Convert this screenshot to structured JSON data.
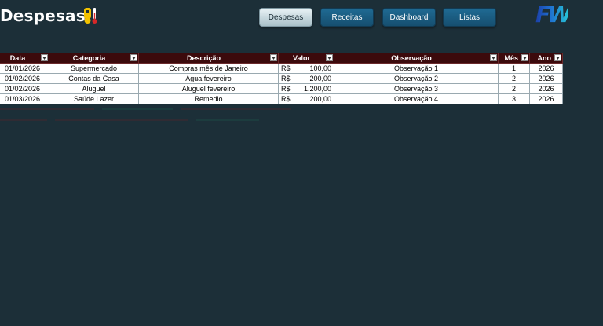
{
  "header": {
    "title": "Despesas",
    "icon": "thermometer-money-icon",
    "logo": "FW"
  },
  "nav": {
    "buttons": [
      {
        "label": "Despesas",
        "active": true
      },
      {
        "label": "Receitas",
        "active": false
      },
      {
        "label": "Dashboard",
        "active": false
      },
      {
        "label": "Listas",
        "active": false
      }
    ]
  },
  "table": {
    "headers": [
      "Data",
      "Categoria",
      "Descrição",
      "Valor",
      "Observação",
      "Mês",
      "Ano"
    ],
    "rows": [
      {
        "data": "01/01/2026",
        "categoria": "Supermercado",
        "descricao": "Compras mês de Janeiro",
        "moeda": "R$",
        "valor": "100,00",
        "observacao": "Observação 1",
        "mes": "1",
        "ano": "2026"
      },
      {
        "data": "01/02/2026",
        "categoria": "Contas da Casa",
        "descricao": "Agua fevereiro",
        "moeda": "R$",
        "valor": "200,00",
        "observacao": "Observação 2",
        "mes": "2",
        "ano": "2026"
      },
      {
        "data": "01/02/2026",
        "categoria": "Aluguel",
        "descricao": "Aluguel fevereiro",
        "moeda": "R$",
        "valor": "1.200,00",
        "observacao": "Observação 3",
        "mes": "2",
        "ano": "2026"
      },
      {
        "data": "01/03/2026",
        "categoria": "Saúde Lazer",
        "descricao": "Remedio",
        "moeda": "R$",
        "valor": "200,00",
        "observacao": "Observação 4",
        "mes": "3",
        "ano": "2026"
      }
    ]
  },
  "colors": {
    "background": "#1c2f38",
    "header_fill": "#3c0a0c",
    "button": "#1a5e84"
  }
}
